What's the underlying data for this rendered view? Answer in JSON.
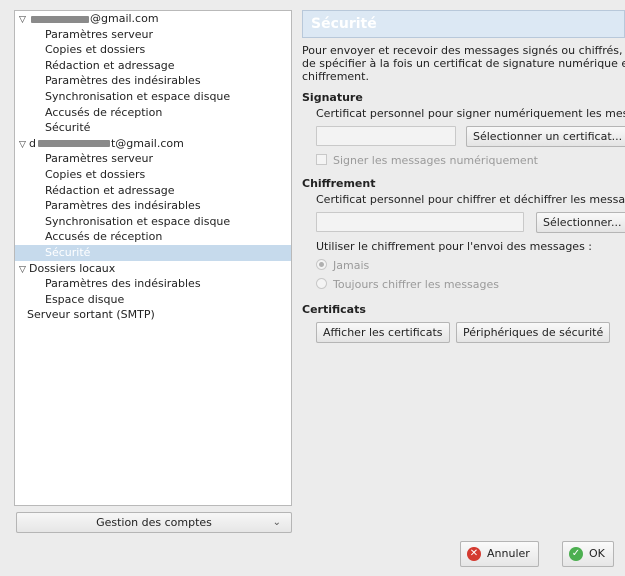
{
  "tree": {
    "account1": {
      "email_suffix": "@gmail.com"
    },
    "account1_items": [
      "Paramètres serveur",
      "Copies et dossiers",
      "Rédaction et adressage",
      "Paramètres des indésirables",
      "Synchronisation et espace disque",
      "Accusés de réception",
      "Sécurité"
    ],
    "account2": {
      "prefix": "d",
      "email_suffix": "t@gmail.com"
    },
    "account2_items": [
      "Paramètres serveur",
      "Copies et dossiers",
      "Rédaction et adressage",
      "Paramètres des indésirables",
      "Synchronisation et espace disque",
      "Accusés de réception",
      "Sécurité"
    ],
    "local": {
      "label": "Dossiers locaux",
      "items": [
        "Paramètres des indésirables",
        "Espace disque"
      ]
    },
    "smtp": "Serveur sortant (SMTP)"
  },
  "account_actions": {
    "label": "Gestion des comptes"
  },
  "panel": {
    "title": "Sécurité",
    "intro_lines": [
      "Pour envoyer et recevoir des messages signés ou chiffrés, il",
      "de spécifier à la fois un certificat de signature numérique et",
      "chiffrement."
    ],
    "signature": {
      "heading": "Signature",
      "desc": "Certificat personnel pour signer numériquement les mes",
      "select_button": "Sélectionner un certificat...",
      "checkbox_label": "Signer les messages numériquement"
    },
    "encryption": {
      "heading": "Chiffrement",
      "desc": "Certificat personnel pour chiffrer et déchiffrer les messag",
      "select_button": "Sélectionner...",
      "use_label": "Utiliser le chiffrement pour l'envoi des messages :",
      "option_never": "Jamais",
      "option_always": "Toujours chiffrer les messages"
    },
    "certs": {
      "heading": "Certificats",
      "view_button": "Afficher les certificats",
      "devices_button": "Périphériques de sécurité"
    }
  },
  "dialog": {
    "cancel": "Annuler",
    "ok": "OK"
  },
  "colors": {
    "selection": "#c6daec",
    "header": "#dce8f4"
  }
}
